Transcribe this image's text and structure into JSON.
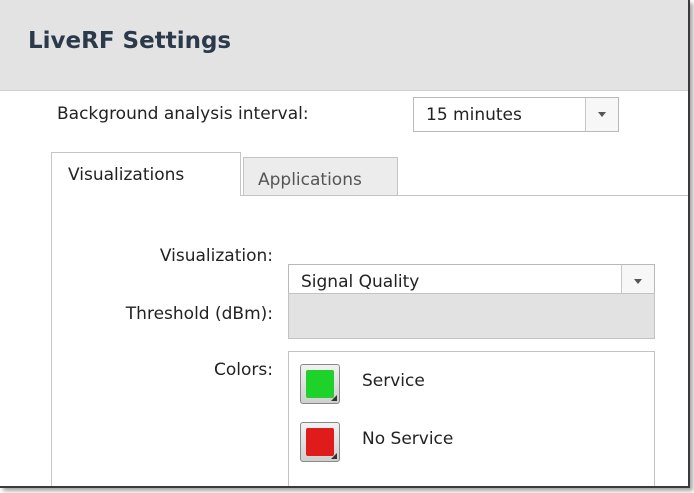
{
  "panel": {
    "title": "LiveRF Settings"
  },
  "interval": {
    "label": "Background analysis interval:",
    "value": "15 minutes"
  },
  "tabs": [
    {
      "label": "Visualizations",
      "active": true
    },
    {
      "label": "Applications",
      "active": false
    }
  ],
  "visualizations": {
    "visualization_label": "Visualization:",
    "visualization_value": "Signal Quality",
    "threshold_label": "Threshold (dBm):",
    "threshold_value": "",
    "colors_label": "Colors:",
    "colors": [
      {
        "label": "Service",
        "color": "#1ed12b"
      },
      {
        "label": "No Service",
        "color": "#e01b1b"
      }
    ]
  }
}
